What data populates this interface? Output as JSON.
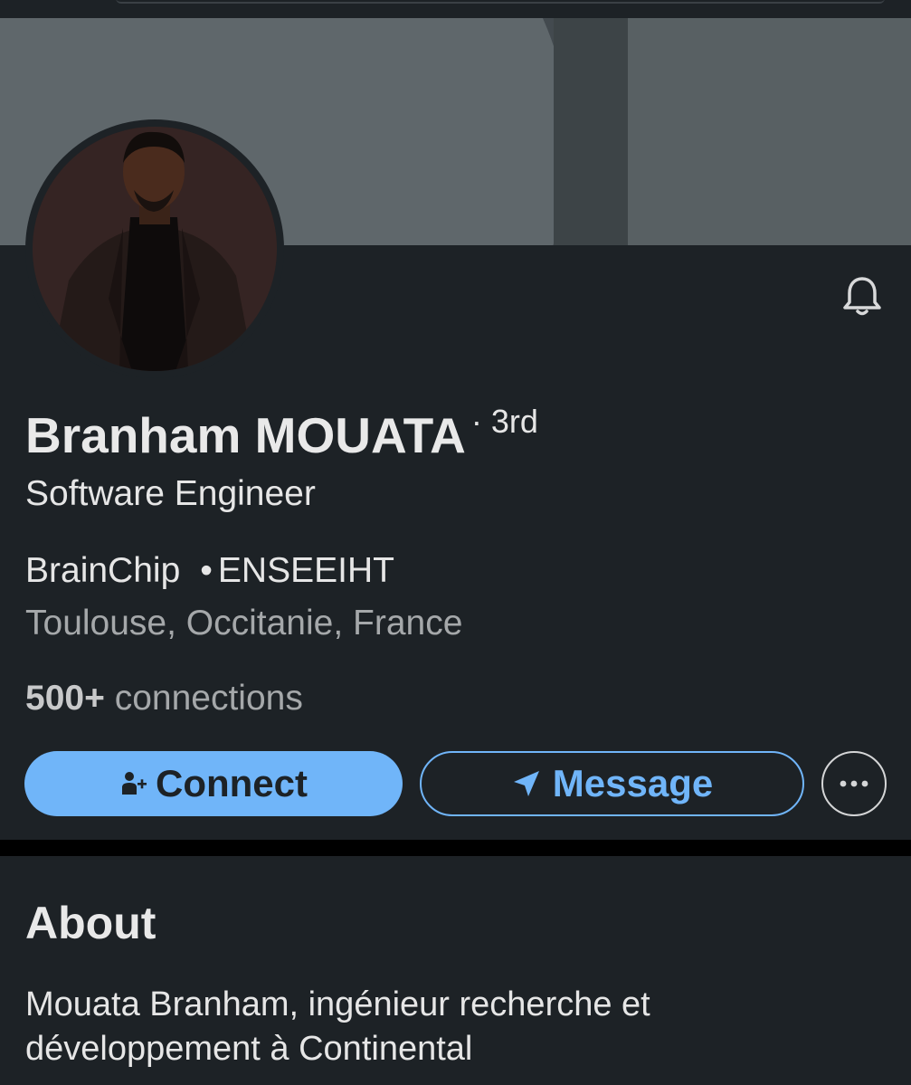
{
  "profile": {
    "name": "Branham MOUATA",
    "degree": "· 3rd",
    "headline": "Software Engineer",
    "company": "BrainChip",
    "separator": "•",
    "school": "ENSEEIHT",
    "location": "Toulouse, Occitanie, France",
    "connections_count": "500+",
    "connections_label": "connections"
  },
  "actions": {
    "connect_label": "Connect",
    "message_label": "Message"
  },
  "about": {
    "title": "About",
    "text": "Mouata Branham, ingénieur recherche et développement à Continental"
  },
  "icons": {
    "bell": "bell-icon",
    "connect": "person-add-icon",
    "message": "send-icon",
    "more": "more-horizontal-icon"
  },
  "colors": {
    "background": "#1d2226",
    "accent": "#70b5f9",
    "banner": "#5f676b"
  }
}
